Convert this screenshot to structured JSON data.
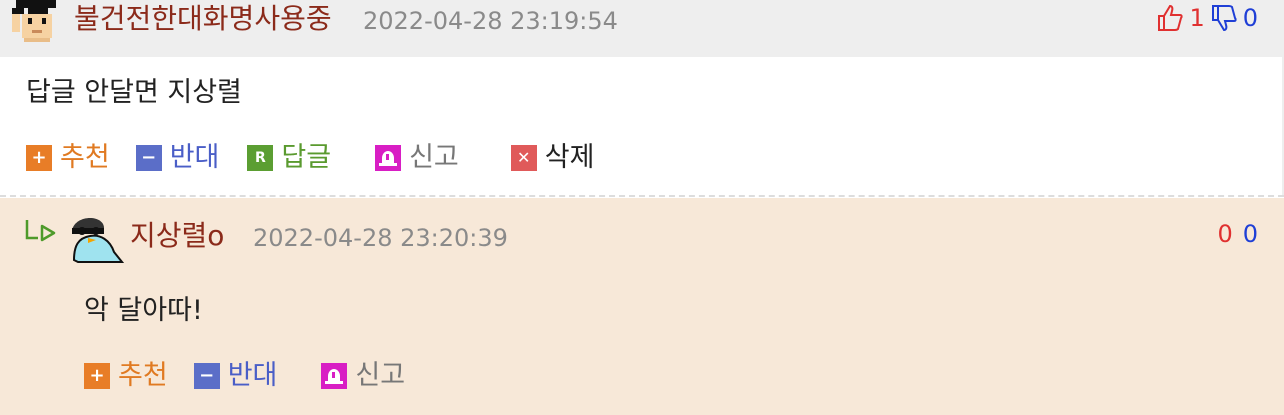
{
  "comment1": {
    "nickname": "불건전한대화명사용중",
    "datetime": "2022-04-28 23:19:54",
    "up_count": "1",
    "down_count": "0",
    "text": "답글 안달면 지상렬",
    "actions": {
      "recommend": "추천",
      "oppose": "반대",
      "reply": "답글",
      "report": "신고",
      "delete": "삭제"
    }
  },
  "reply1": {
    "nickname": "지상렬o",
    "datetime": "2022-04-28 23:20:39",
    "up_count": "0",
    "down_count": "0",
    "text": "악 달아따!",
    "actions": {
      "recommend": "추천",
      "oppose": "반대",
      "report": "신고"
    }
  },
  "icons": {
    "recommend_icon": "plus-icon",
    "oppose_icon": "minus-icon",
    "reply_icon": "reply-r-icon",
    "report_icon": "siren-icon",
    "delete_icon": "x-icon",
    "thumbs_up": "thumbs-up-icon",
    "thumbs_down": "thumbs-down-icon"
  },
  "colors": {
    "nickname": "#8b2a1a",
    "recommend": "#e07a22",
    "oppose": "#4a5ec7",
    "reply": "#5a9a2f",
    "up": "#e03030",
    "down": "#1f3fd6",
    "reply_background": "#f7e8d8"
  }
}
